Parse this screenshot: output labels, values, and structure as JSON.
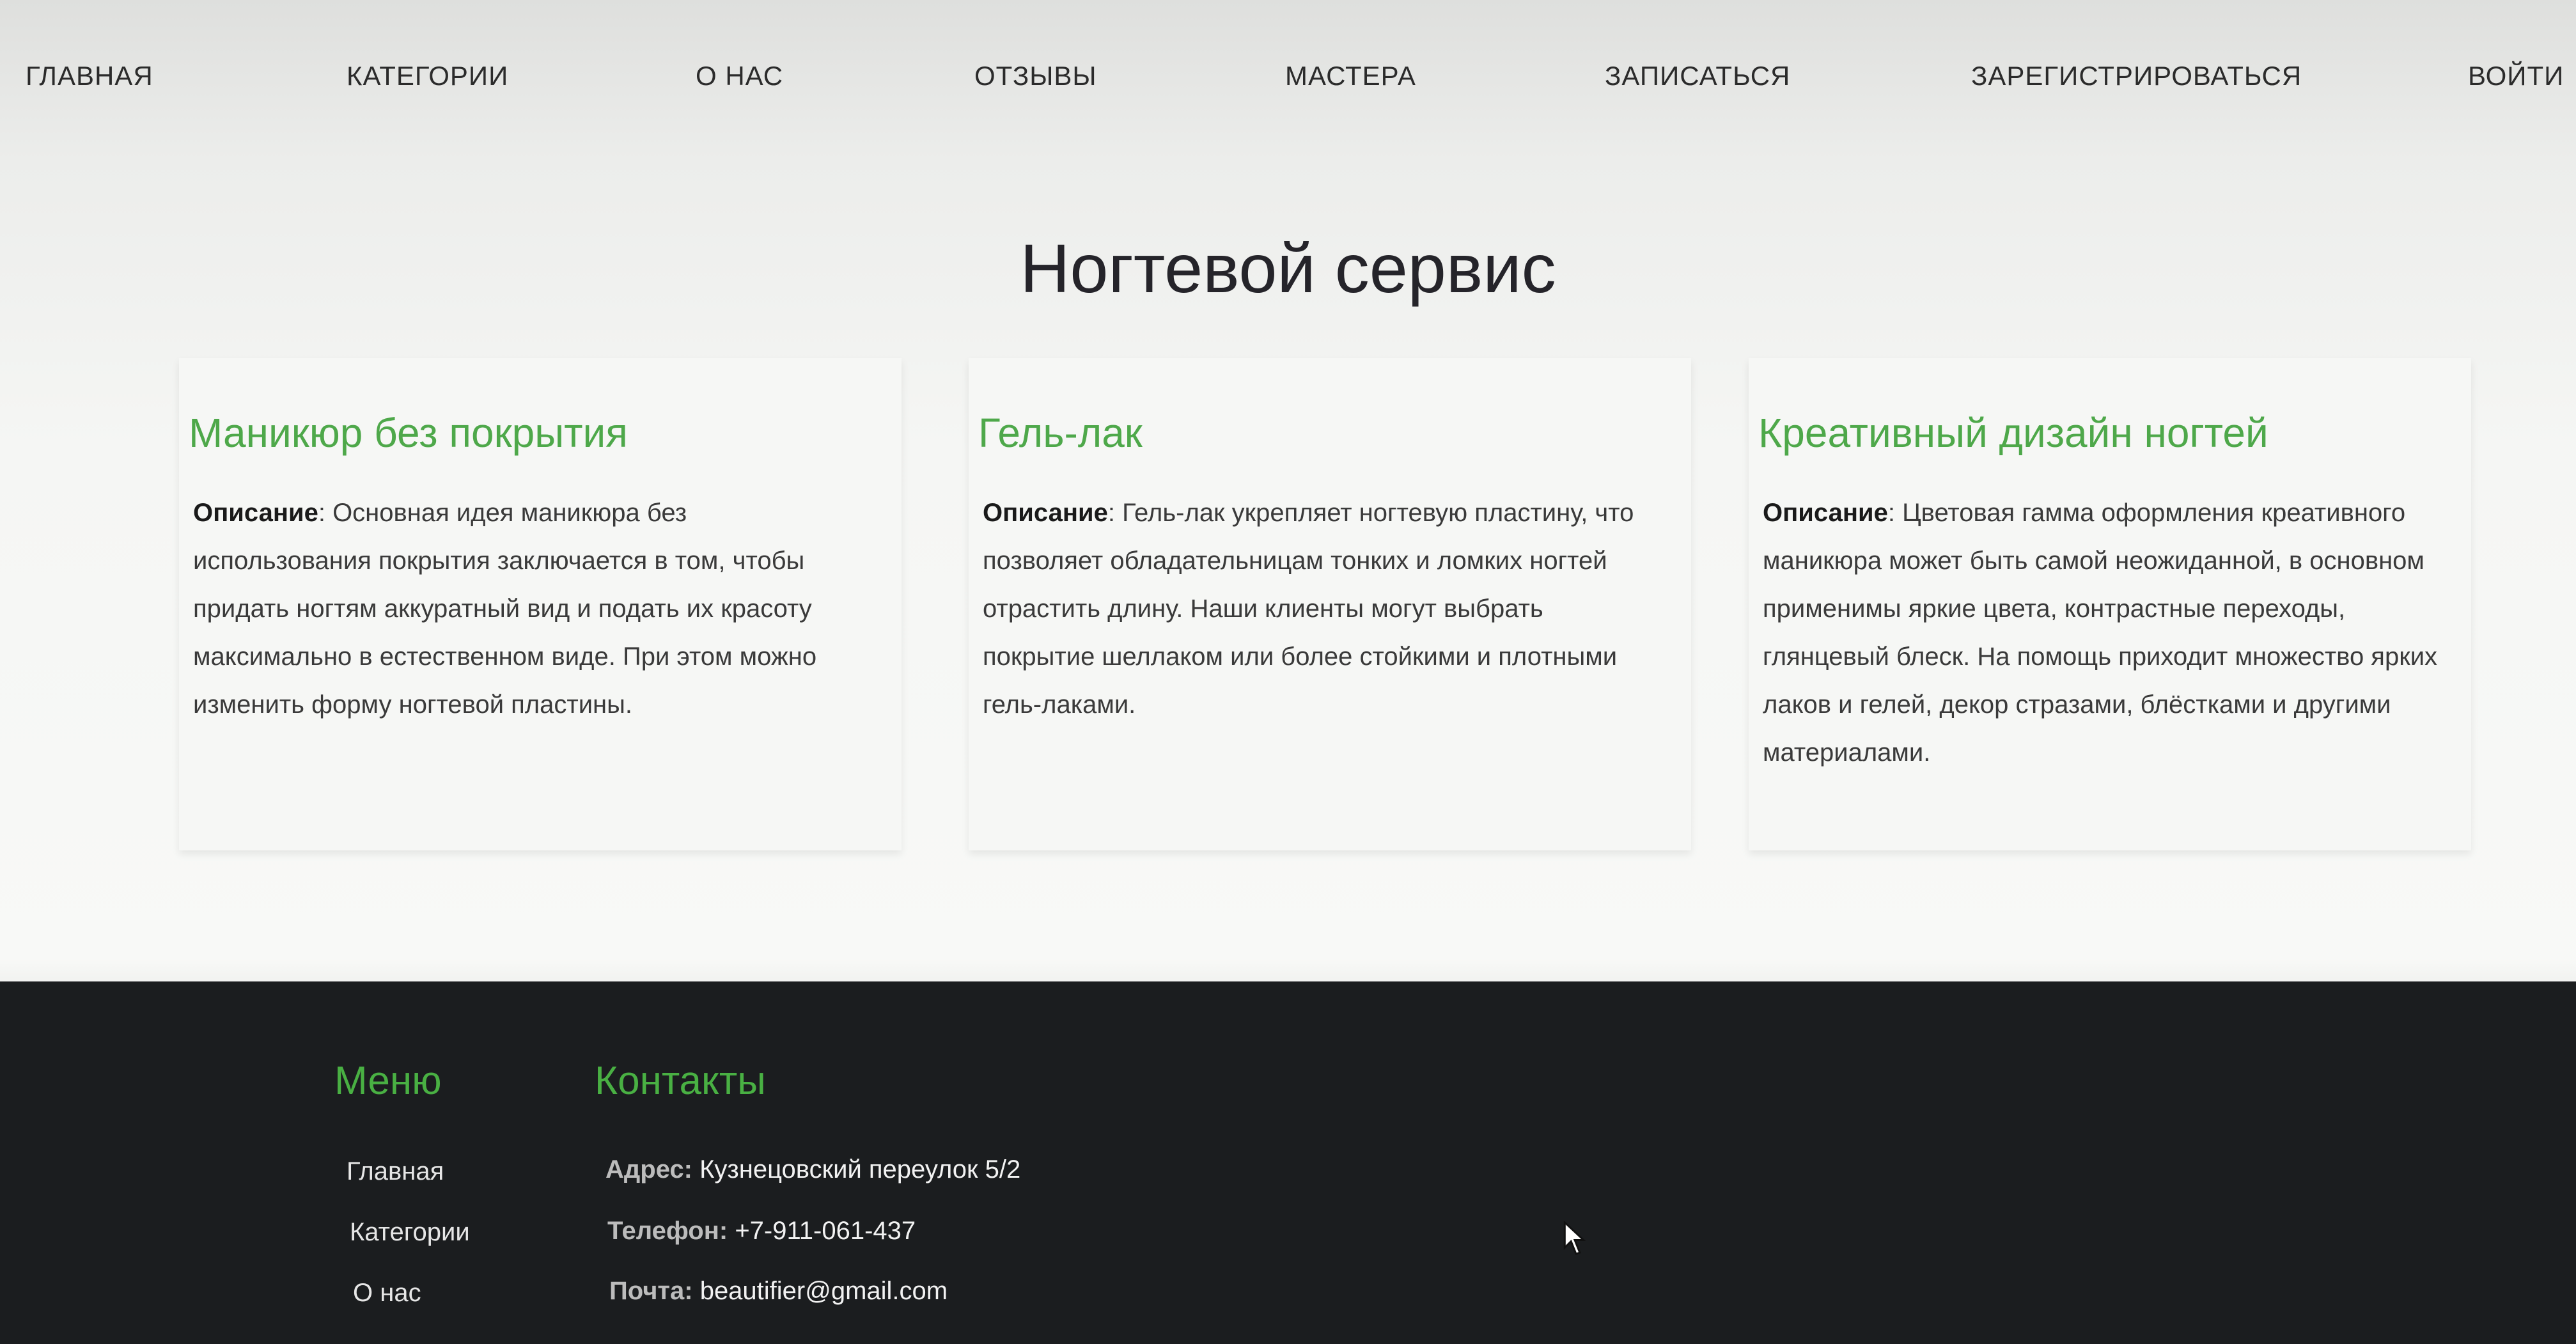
{
  "nav": {
    "items": [
      "ГЛАВНАЯ",
      "КАТЕГОРИИ",
      "О НАС",
      "ОТЗЫВЫ",
      "МАСТЕРА",
      "ЗАПИСАТЬСЯ",
      "ЗАРЕГИСТРИРОВАТЬСЯ",
      "ВОЙТИ"
    ]
  },
  "page": {
    "title": "Ногтевой сервис"
  },
  "cards": [
    {
      "title": "Маникюр без покрытия",
      "desc_label": "Описание",
      "desc_text": ": Основная идея маникюра без использования покрытия заключается в том, чтобы придать ногтям аккуратный вид и подать их красоту максимально в естественном виде. При этом можно изменить форму ногтевой пластины."
    },
    {
      "title": "Гель-лак",
      "desc_label": "Описание",
      "desc_text": ": Гель-лак укрепляет ногтевую пластину, что позволяет обладательницам тонких и ломких ногтей отрастить длину. Наши клиенты могут выбрать покрытие шеллаком или более стойкими и плотными гель-лаками."
    },
    {
      "title": "Креативный дизайн ногтей",
      "desc_label": "Описание",
      "desc_text": ": Цветовая гамма оформления креативного маникюра может быть самой неожиданной, в основном применимы яркие цвета, контрастные переходы, глянцевый блеск. На помощь приходит множество ярких лаков и гелей, декор стразами, блёстками и другими материалами."
    }
  ],
  "footer": {
    "menu_heading": "Меню",
    "menu_items": [
      "Главная",
      "Категории",
      "О нас"
    ],
    "contacts_heading": "Контакты",
    "contacts": [
      {
        "label": "Адрес:",
        "value": " Кузнецовский переулок 5/2"
      },
      {
        "label": "Телефон:",
        "value": " +7-911-061-437"
      },
      {
        "label": "Почта:",
        "value": " beautifier@gmail.com"
      }
    ]
  },
  "colors": {
    "accent": "#4ea84a",
    "footer_bg": "#1b1d1f",
    "page_bg": "#f4f4f2"
  }
}
